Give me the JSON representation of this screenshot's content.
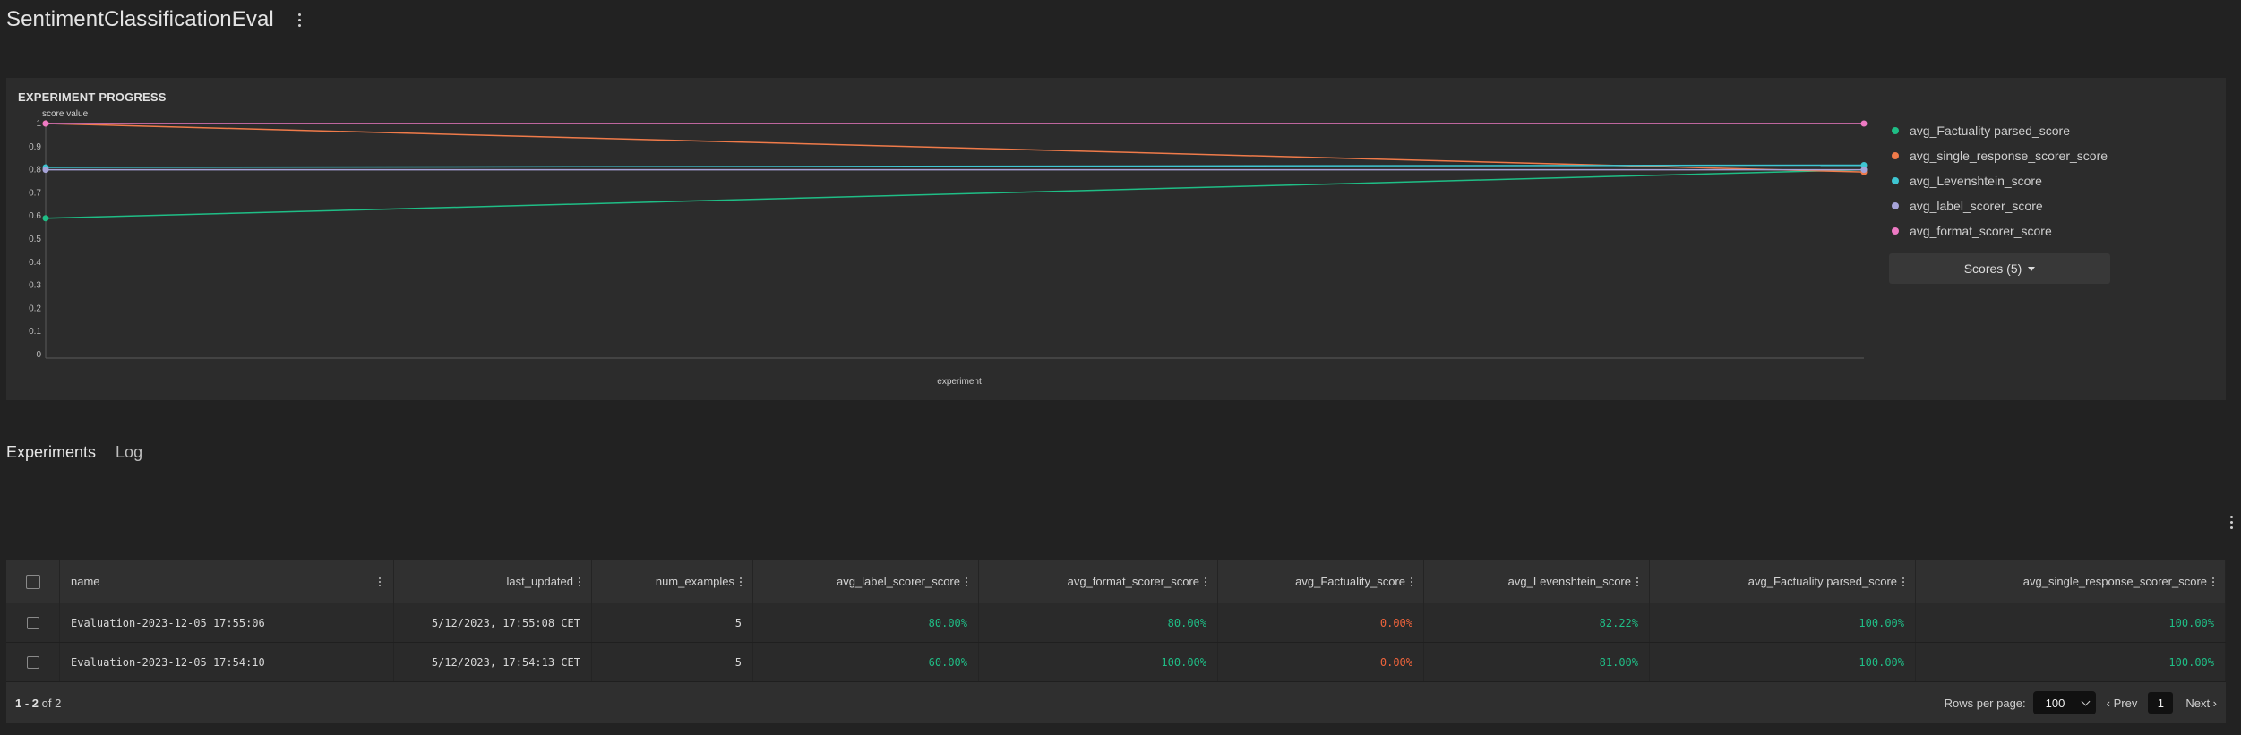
{
  "header": {
    "title": "SentimentClassificationEval"
  },
  "progress": {
    "title": "EXPERIMENT PROGRESS",
    "scores_button_label": "Scores (5)"
  },
  "chart_data": {
    "type": "line",
    "ylabel": "score value",
    "xlabel": "experiment",
    "ylim": [
      0,
      1
    ],
    "yticks": [
      "0",
      "0.1",
      "0.2",
      "0.3",
      "0.4",
      "0.5",
      "0.6",
      "0.7",
      "0.8",
      "0.9",
      "1"
    ],
    "grid": false,
    "legend_position": "right",
    "series": [
      {
        "name": "avg_Factuality parsed_score",
        "color": "#1fbe86",
        "values": [
          0.59,
          0.8
        ]
      },
      {
        "name": "avg_single_response_scorer_score",
        "color": "#f07b4a",
        "values": [
          1.0,
          0.79
        ]
      },
      {
        "name": "avg_Levenshtein_score",
        "color": "#3ec6d2",
        "values": [
          0.81,
          0.82
        ]
      },
      {
        "name": "avg_label_scorer_score",
        "color": "#a6a3d8",
        "values": [
          0.8,
          0.8
        ]
      },
      {
        "name": "avg_format_scorer_score",
        "color": "#ee7ac4",
        "values": [
          1.0,
          1.0
        ]
      }
    ]
  },
  "tabs": [
    {
      "label": "Experiments",
      "active": true
    },
    {
      "label": "Log",
      "active": false
    }
  ],
  "table": {
    "columns": [
      "name",
      "last_updated",
      "num_examples",
      "avg_label_scorer_score",
      "avg_format_scorer_score",
      "avg_Factuality_score",
      "avg_Levenshtein_score",
      "avg_Factuality parsed_score",
      "avg_single_response_scorer_score"
    ],
    "rows": [
      {
        "name": "Evaluation-2023-12-05 17:55:06",
        "last_updated": "5/12/2023, 17:55:08 CET",
        "num_examples": "5",
        "avg_label_scorer_score": "80.00%",
        "avg_format_scorer_score": "80.00%",
        "avg_Factuality_score": "0.00%",
        "avg_Levenshtein_score": "82.22%",
        "avg_Factuality_parsed_score": "100.00%",
        "avg_single_response_scorer_score": "100.00%"
      },
      {
        "name": "Evaluation-2023-12-05 17:54:10",
        "last_updated": "5/12/2023, 17:54:13 CET",
        "num_examples": "5",
        "avg_label_scorer_score": "60.00%",
        "avg_format_scorer_score": "100.00%",
        "avg_Factuality_score": "0.00%",
        "avg_Levenshtein_score": "81.00%",
        "avg_Factuality_parsed_score": "100.00%",
        "avg_single_response_scorer_score": "100.00%"
      }
    ],
    "footer": {
      "range": "1 - 2",
      "of_label": "of 2",
      "rows_per_page_label": "Rows per page:",
      "rows_per_page_value": "100",
      "prev_label": "‹ Prev",
      "page": "1",
      "next_label": "Next ›"
    }
  }
}
